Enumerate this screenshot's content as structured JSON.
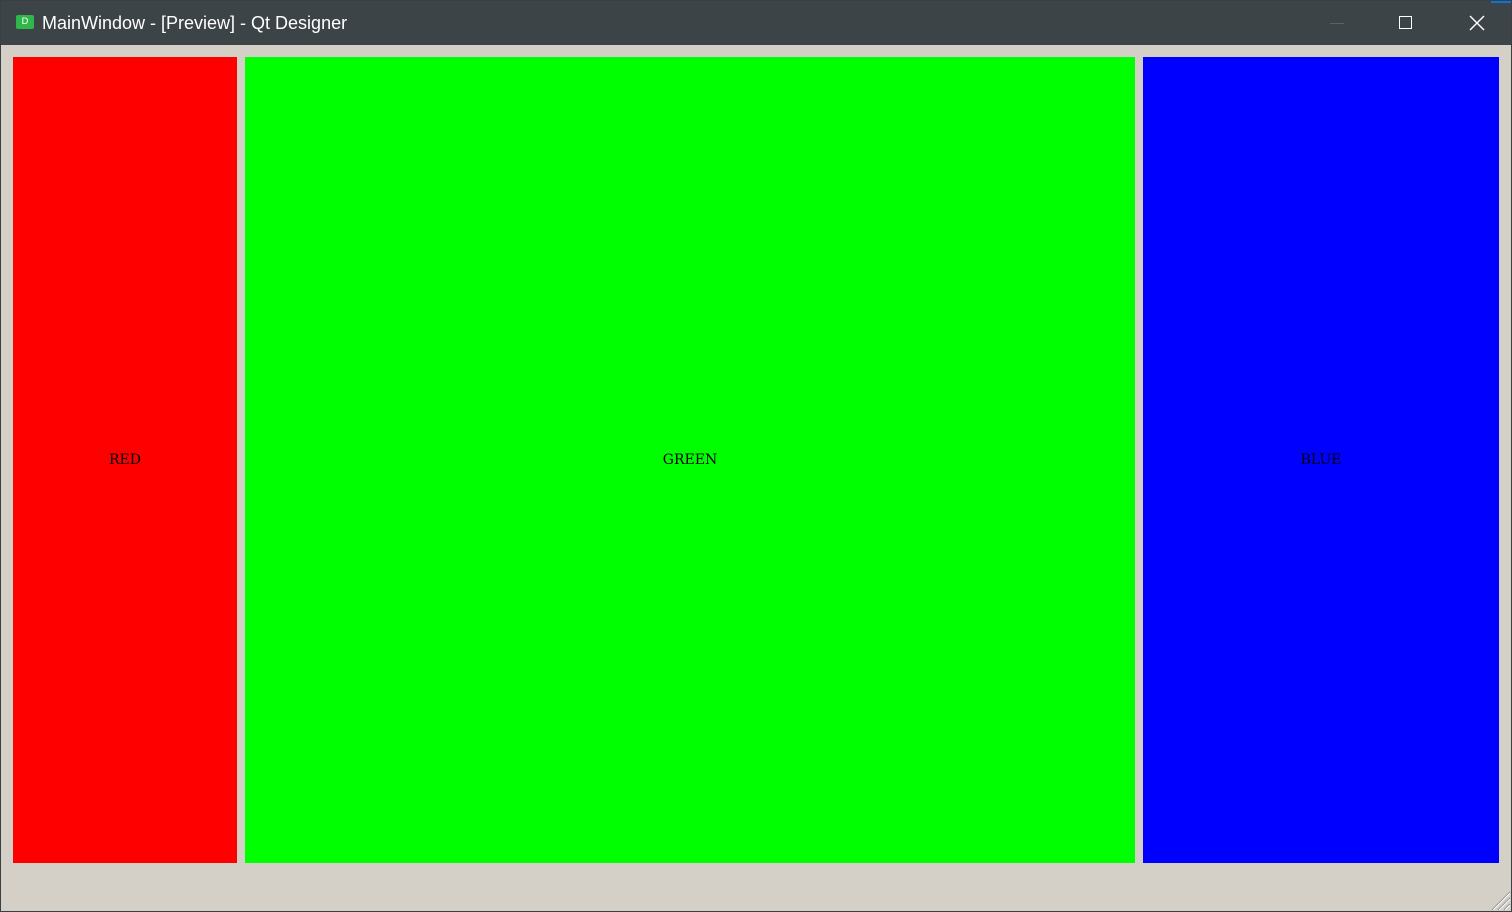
{
  "window": {
    "title": "MainWindow - [Preview] - Qt Designer",
    "app_icon_glyph": "D",
    "app_icon_name": "qt-designer-icon",
    "title_bar_color": "#3c4448",
    "accent_color": "#0a74d8"
  },
  "controls": {
    "minimize_icon": "minimize-icon",
    "maximize_icon": "maximize-icon",
    "close_icon": "close-icon"
  },
  "client_background": "#d4d0c8",
  "panels": [
    {
      "label": "RED",
      "color": "#ff0000"
    },
    {
      "label": "GREEN",
      "color": "#00ff00"
    },
    {
      "label": "BLUE",
      "color": "#0000ff"
    }
  ],
  "size_grip_icon": "resize-grip-icon"
}
